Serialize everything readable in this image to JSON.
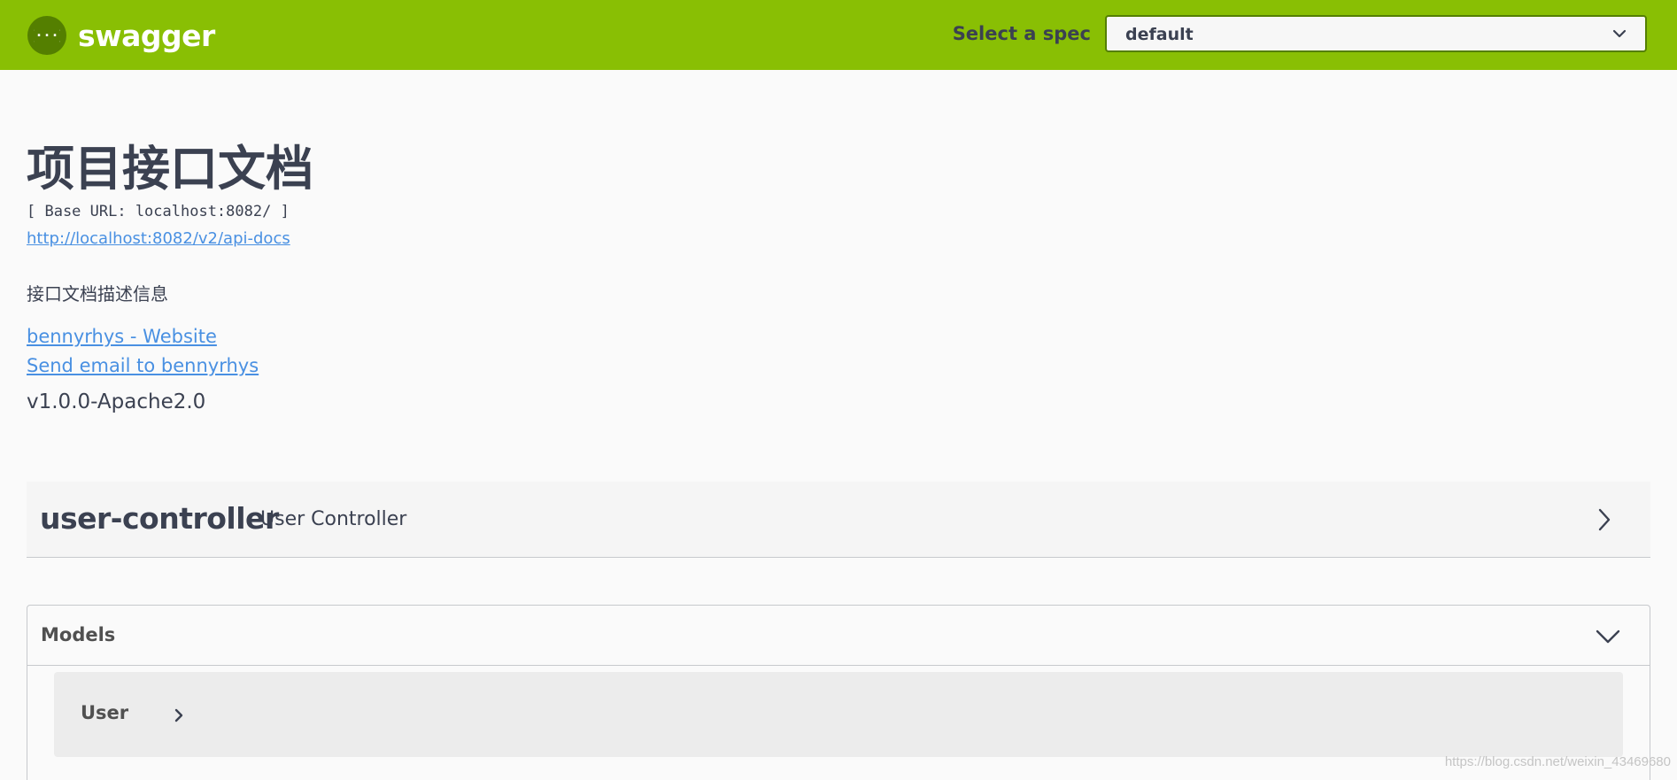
{
  "topbar": {
    "logo_text": "swagger",
    "logo_icon": "swagger-braces-icon",
    "spec_label": "Select a spec",
    "spec_selected": "default",
    "colors": {
      "background": "#89bf04",
      "select_border": "#547f00"
    }
  },
  "info": {
    "title": "项目接口文档",
    "base_url": "[ Base URL: localhost:8082/ ]",
    "api_docs_url": "http://localhost:8082/v2/api-docs",
    "description": "接口文档描述信息",
    "website_link": "bennyrhys - Website",
    "email_link": "Send email to bennyrhys",
    "version_license": "v1.0.0-Apache2.0",
    "link_color": "#4990e2"
  },
  "tags": [
    {
      "name": "user-controller",
      "description": "User Controller",
      "icon": "chevron-right-icon"
    }
  ],
  "models": {
    "title": "Models",
    "toggle_icon": "chevron-down-icon",
    "items": [
      {
        "name": "User",
        "icon": "chevron-right-icon"
      }
    ]
  },
  "watermark": "https://blog.csdn.net/weixin_43469680"
}
